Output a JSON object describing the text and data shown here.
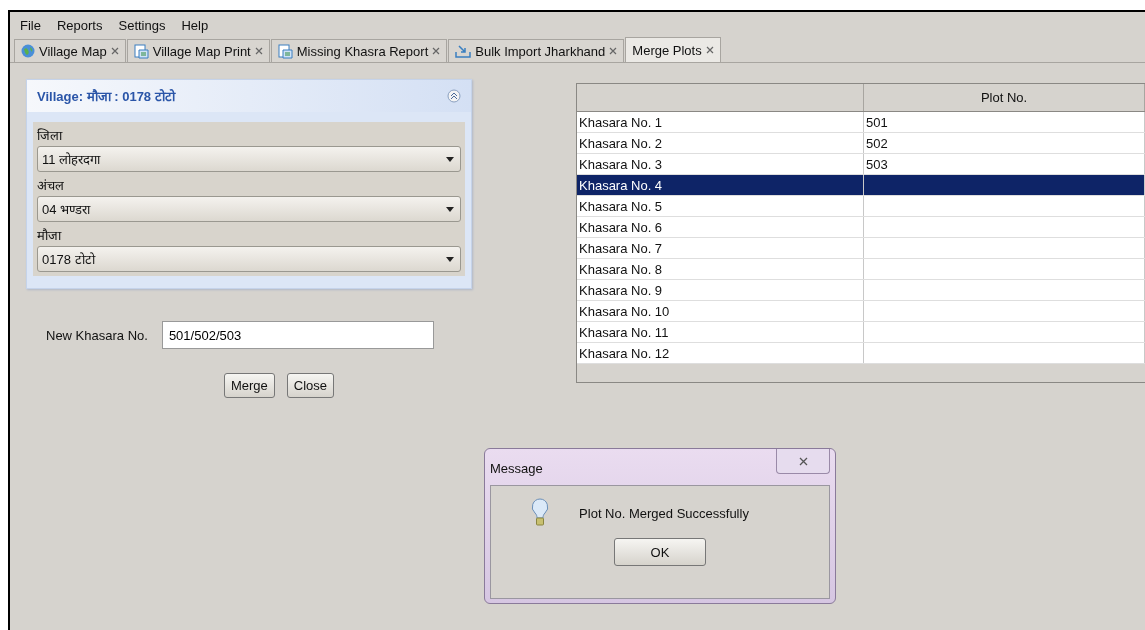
{
  "menu": [
    "File",
    "Reports",
    "Settings",
    "Help"
  ],
  "tabs": [
    {
      "label": "Village Map",
      "kind": "globe",
      "selected": false
    },
    {
      "label": "Village Map Print",
      "kind": "document",
      "selected": false
    },
    {
      "label": "Missing Khasra Report",
      "kind": "document",
      "selected": false
    },
    {
      "label": "Bulk Import Jharkhand",
      "kind": "tray",
      "selected": false
    },
    {
      "label": "Merge Plots",
      "kind": "plain",
      "selected": true
    }
  ],
  "village_panel": {
    "title": "Village: मौजा : 0178 टोटो",
    "expanded": true,
    "fields": [
      {
        "label": "जिला",
        "value": "11 लोहरदगा"
      },
      {
        "label": "अंचल",
        "value": "04 भण्डरा"
      },
      {
        "label": "मौजा",
        "value": "0178 टोटो"
      }
    ]
  },
  "new_khasara": {
    "label": "New Khasara No.",
    "value": "501/502/503"
  },
  "buttons": [
    "Merge",
    "Close"
  ],
  "table": {
    "columns": [
      "Plot No."
    ],
    "rows": [
      {
        "name": "Khasara No. 1",
        "plot": "501",
        "selected": false
      },
      {
        "name": "Khasara No. 2",
        "plot": "502",
        "selected": false
      },
      {
        "name": "Khasara No. 3",
        "plot": "503",
        "selected": false
      },
      {
        "name": "Khasara No. 4",
        "selected": true
      },
      {
        "name": "Khasara No. 5",
        "selected": false
      },
      {
        "name": "Khasara No. 6",
        "selected": false
      },
      {
        "name": "Khasara No. 7",
        "selected": false
      },
      {
        "name": "Khasara No. 8",
        "selected": false
      },
      {
        "name": "Khasara No. 9",
        "selected": false
      },
      {
        "name": "Khasara No. 10",
        "selected": false
      },
      {
        "name": "Khasara No. 11",
        "selected": false
      },
      {
        "name": "Khasara No. 12",
        "selected": false
      }
    ]
  },
  "dialog": {
    "title": "Message",
    "message": "Plot No. Merged Successfully",
    "button": "OK"
  }
}
